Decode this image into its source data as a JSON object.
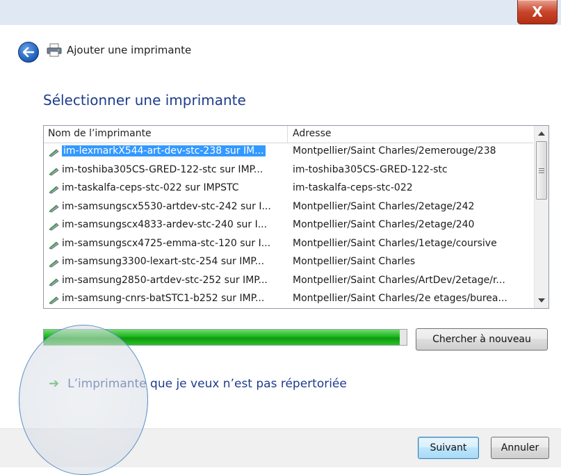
{
  "window": {
    "title": "Ajouter une imprimante",
    "close_label": "X"
  },
  "heading": "Sélectionner une imprimante",
  "list": {
    "columns": [
      "Nom de l’imprimante",
      "Adresse"
    ],
    "rows": [
      {
        "name": "im-lexmarkX544-art-dev-stc-238 sur IM...",
        "address": "Montpellier/Saint Charles/2emerouge/238"
      },
      {
        "name": "im-toshiba305CS-GRED-122-stc sur IMP...",
        "address": "im-toshiba305CS-GRED-122-stc"
      },
      {
        "name": "im-taskalfa-ceps-stc-022 sur IMPSTC",
        "address": "im-taskalfa-ceps-stc-022"
      },
      {
        "name": "im-samsungscx5530-artdev-stc-242 sur I...",
        "address": "Montpellier/Saint Charles/2etage/242"
      },
      {
        "name": "im-samsungscx4833-ardev-stc-240 sur I...",
        "address": "Montpellier/Saint Charles/2etage/240"
      },
      {
        "name": "im-samsungscx4725-emma-stc-120 sur I...",
        "address": "Montpellier/Saint Charles/1etage/coursive"
      },
      {
        "name": "im-samsung3300-lexart-stc-254 sur IMP...",
        "address": "Montpellier/Saint Charles"
      },
      {
        "name": "im-samsung2850-artdev-stc-252 sur IMP...",
        "address": "Montpellier/Saint Charles/ArtDev/2etage/r..."
      },
      {
        "name": "im-samsung-cnrs-batSTC1-b252 sur IMP...",
        "address": "Montpellier/Saint Charles/2e etages/burea..."
      }
    ],
    "selected_index": 0
  },
  "progress": {
    "fraction": 0.98,
    "color": "#1fb41f"
  },
  "buttons": {
    "search_again": "Chercher à nouveau",
    "next": "Suivant",
    "cancel": "Annuler"
  },
  "link_not_listed": "L’imprimante que je veux n’est pas répertoriée",
  "icons": {
    "back": "back-arrow-icon",
    "printer": "printer-icon",
    "link_arrow": "green-arrow-icon"
  }
}
